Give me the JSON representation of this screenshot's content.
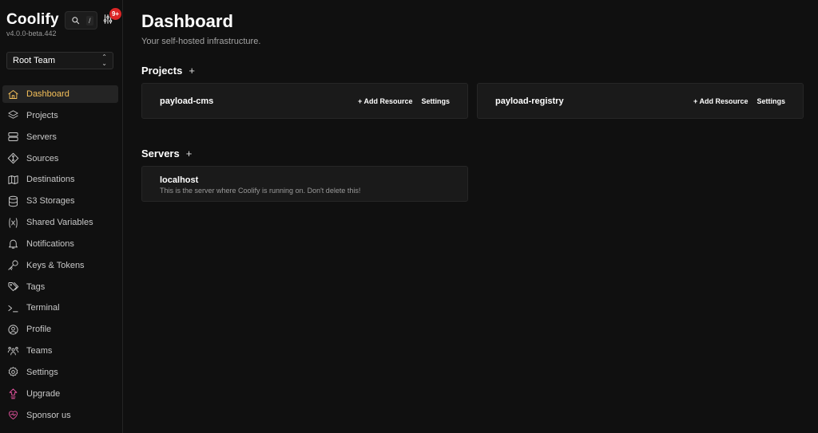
{
  "app": {
    "brand": "Coolify",
    "version": "v4.0.0-beta.442",
    "search_shortcut": "/",
    "notification_badge": "9+",
    "team": "Root Team"
  },
  "sidebar": {
    "items": [
      {
        "label": "Dashboard",
        "icon": "home-icon"
      },
      {
        "label": "Projects",
        "icon": "layers-icon"
      },
      {
        "label": "Servers",
        "icon": "server-icon"
      },
      {
        "label": "Sources",
        "icon": "git-icon"
      },
      {
        "label": "Destinations",
        "icon": "map-icon"
      },
      {
        "label": "S3 Storages",
        "icon": "database-icon"
      },
      {
        "label": "Shared Variables",
        "icon": "variable-icon"
      },
      {
        "label": "Notifications",
        "icon": "bell-icon"
      },
      {
        "label": "Keys & Tokens",
        "icon": "key-icon"
      },
      {
        "label": "Tags",
        "icon": "tag-icon"
      },
      {
        "label": "Terminal",
        "icon": "terminal-icon"
      },
      {
        "label": "Profile",
        "icon": "user-circle-icon"
      },
      {
        "label": "Teams",
        "icon": "users-icon"
      },
      {
        "label": "Settings",
        "icon": "gear-icon"
      },
      {
        "label": "Upgrade",
        "icon": "upgrade-icon"
      },
      {
        "label": "Sponsor us",
        "icon": "heart-icon"
      }
    ],
    "active": "Dashboard",
    "accent_color": "#f6c15a",
    "sponsor_color": "#e0529c"
  },
  "main": {
    "title": "Dashboard",
    "subtitle": "Your self-hosted infrastructure.",
    "projects_heading": "Projects",
    "servers_heading": "Servers",
    "add_symbol": "+",
    "projects": [
      {
        "name": "payload-cms",
        "add_resource": "+ Add Resource",
        "settings": "Settings"
      },
      {
        "name": "payload-registry",
        "add_resource": "+ Add Resource",
        "settings": "Settings"
      }
    ],
    "servers": [
      {
        "name": "localhost",
        "description": "This is the server where Coolify is running on. Don't delete this!"
      }
    ]
  }
}
